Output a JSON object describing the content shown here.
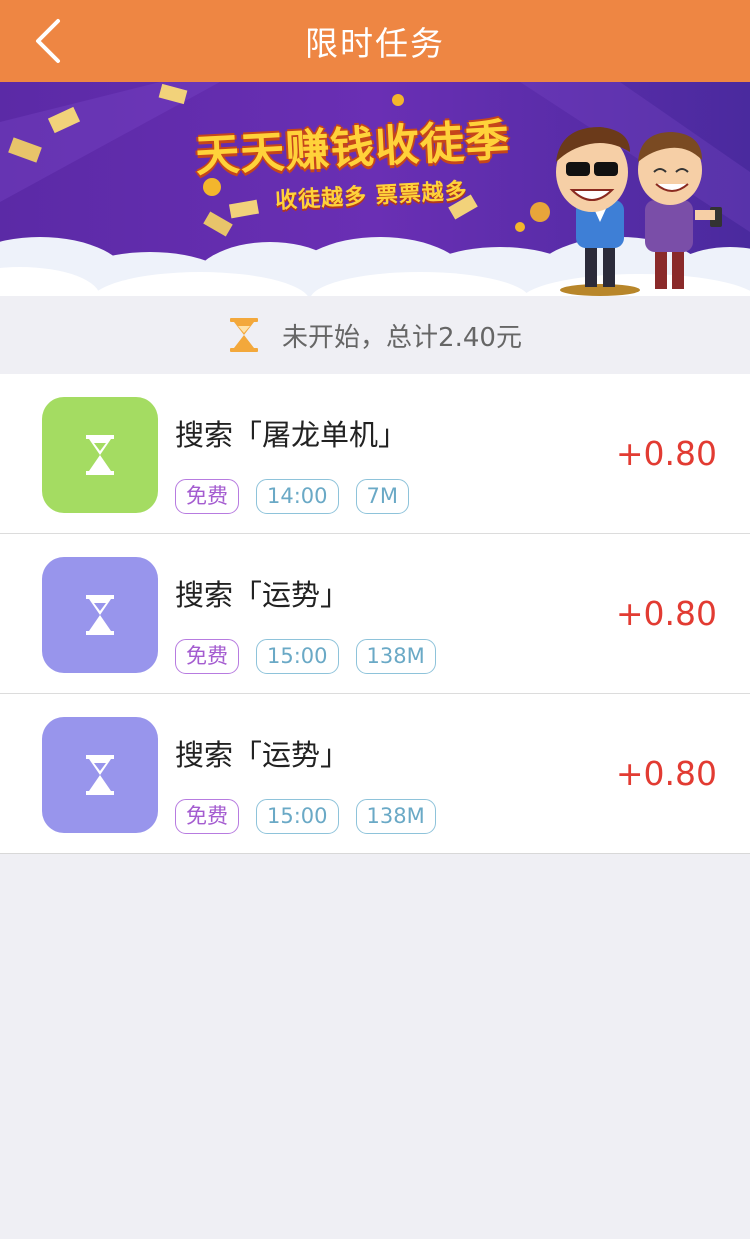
{
  "navbar": {
    "title": "限时任务",
    "back_icon": "chevron-left-icon",
    "background": "#ee8643"
  },
  "banner": {
    "title": "天天赚钱收徒季",
    "subtitle": "收徒越多 票票越多"
  },
  "summary": {
    "icon": "hourglass-icon",
    "text": "未开始，总计2.40元"
  },
  "tasks": [
    {
      "name": "搜索「屠龙单机」",
      "icon_color": "#a4dc62",
      "tags": [
        "免费",
        "14:00",
        "7M"
      ],
      "reward": "+0.80"
    },
    {
      "name": "搜索「运势」",
      "icon_color": "#9895ec",
      "tags": [
        "免费",
        "15:00",
        "138M"
      ],
      "reward": "+0.80"
    },
    {
      "name": "搜索「运势」",
      "icon_color": "#9895ec",
      "tags": [
        "免费",
        "15:00",
        "138M"
      ],
      "reward": "+0.80"
    }
  ],
  "colors": {
    "reward": "#e23b32",
    "free_tag": "#a45cd0",
    "info_tag": "#6aa9c6",
    "background": "#efeff4"
  }
}
